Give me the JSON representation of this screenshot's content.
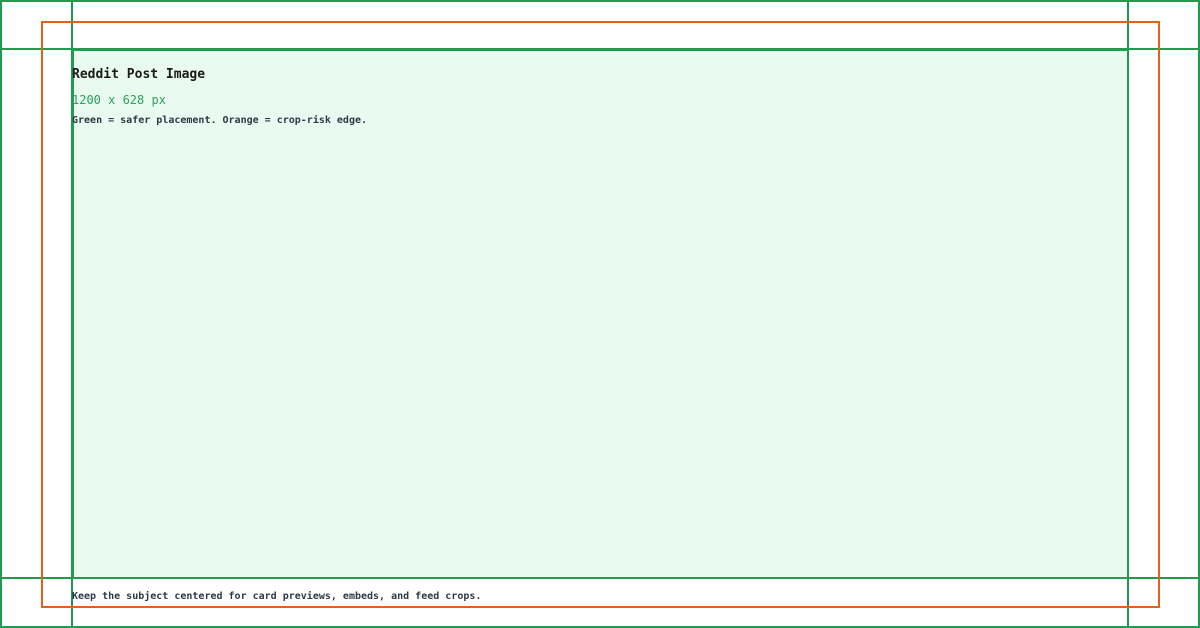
{
  "template": {
    "title": "Reddit Post Image",
    "dimensions": "1200 x 628 px",
    "legend": "Green = safer placement. Orange = crop-risk edge.",
    "footer_note": "Keep the subject centered for card previews, embeds, and feed crops."
  },
  "colors": {
    "safe": "#1f9d4d",
    "safe_fill": "#e9fbf1",
    "crop_risk": "#e0621c",
    "dimensions_text": "#2ea05a"
  }
}
